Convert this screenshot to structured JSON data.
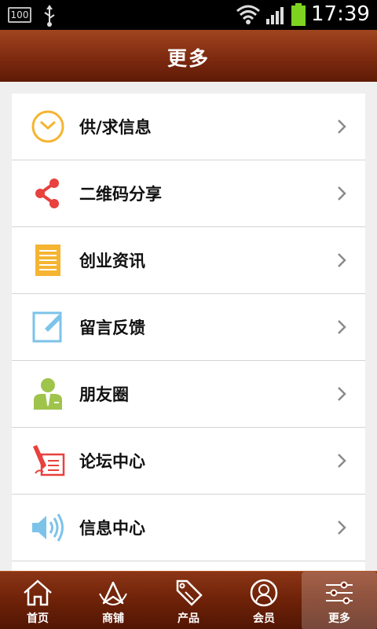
{
  "status_bar": {
    "battery_level": "100",
    "time": "17:39"
  },
  "header": {
    "title": "更多"
  },
  "menu": {
    "items": [
      {
        "label": "供/求信息",
        "icon": "clock-icon"
      },
      {
        "label": "二维码分享",
        "icon": "share-icon"
      },
      {
        "label": "创业资讯",
        "icon": "document-icon"
      },
      {
        "label": "留言反馈",
        "icon": "edit-icon"
      },
      {
        "label": "朋友圈",
        "icon": "person-icon"
      },
      {
        "label": "论坛中心",
        "icon": "pen-paper-icon"
      },
      {
        "label": "信息中心",
        "icon": "speaker-icon"
      }
    ]
  },
  "tab_bar": {
    "tabs": [
      {
        "label": "首页",
        "icon": "home-icon"
      },
      {
        "label": "商铺",
        "icon": "shop-icon"
      },
      {
        "label": "产品",
        "icon": "sale-tag-icon"
      },
      {
        "label": "会员",
        "icon": "member-icon"
      },
      {
        "label": "更多",
        "icon": "settings-sliders-icon"
      }
    ],
    "active": "更多"
  },
  "colors": {
    "header_dark": "#5e1b06",
    "header_light": "#a0451f",
    "clock_icon": "#f5b431",
    "share_icon": "#e8413e",
    "document_icon": "#f5b431",
    "edit_icon": "#7cc3ea",
    "person_icon": "#9fc44c",
    "pen_icon": "#e8413e",
    "speaker_icon": "#7cc3ea"
  }
}
